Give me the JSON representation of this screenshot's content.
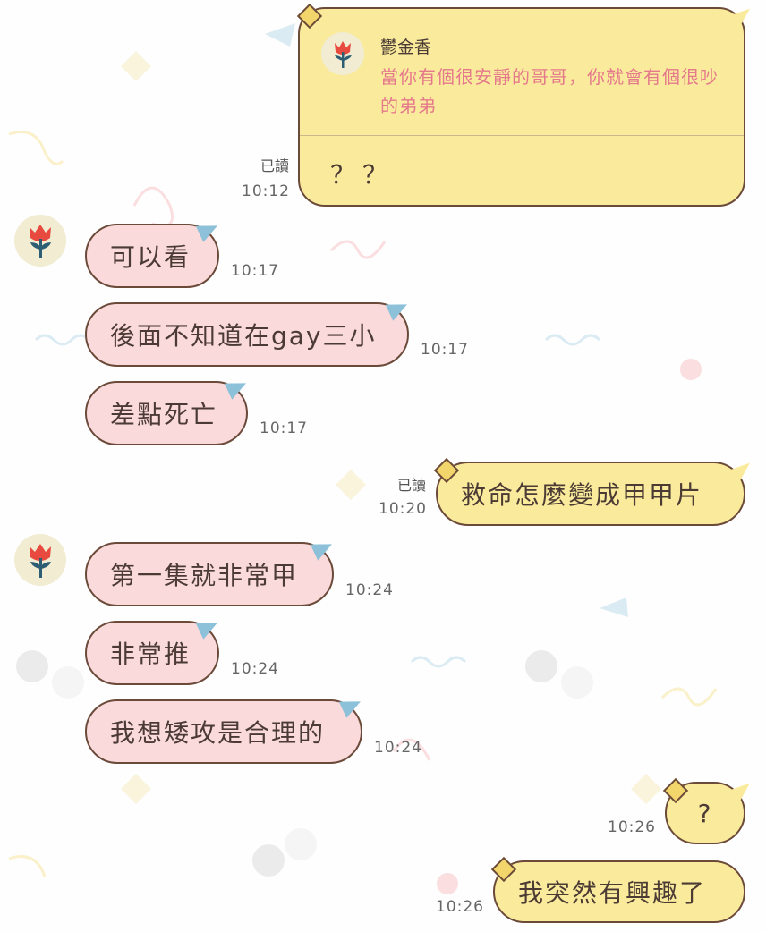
{
  "reply": {
    "sender": "鬱金香",
    "quote": "當你有個很安靜的哥哥，你就會有個很吵的弟弟",
    "text": "？？",
    "read": "已讀",
    "time": "10:12"
  },
  "messages": [
    {
      "side": "in",
      "text": "可以看",
      "time": "10:17"
    },
    {
      "side": "in",
      "text": "後面不知道在gay三小",
      "time": "10:17"
    },
    {
      "side": "in",
      "text": "差點死亡",
      "time": "10:17"
    },
    {
      "side": "out",
      "text": "救命怎麼變成甲甲片",
      "time": "10:20",
      "read": "已讀"
    },
    {
      "side": "in",
      "text": "第一集就非常甲",
      "time": "10:24"
    },
    {
      "side": "in",
      "text": "非常推",
      "time": "10:24"
    },
    {
      "side": "in",
      "text": "我想矮攻是合理的",
      "time": "10:24"
    },
    {
      "side": "out",
      "text": "?",
      "time": "10:26"
    },
    {
      "side": "out",
      "text": "我突然有興趣了",
      "time": "10:26"
    }
  ],
  "colors": {
    "incoming_bubble": "#fadadb",
    "outgoing_bubble": "#faeb9c",
    "bubble_border": "#6b4a3a",
    "quote_text": "#e5798c"
  },
  "icons": {
    "avatar": "tulip-icon"
  }
}
